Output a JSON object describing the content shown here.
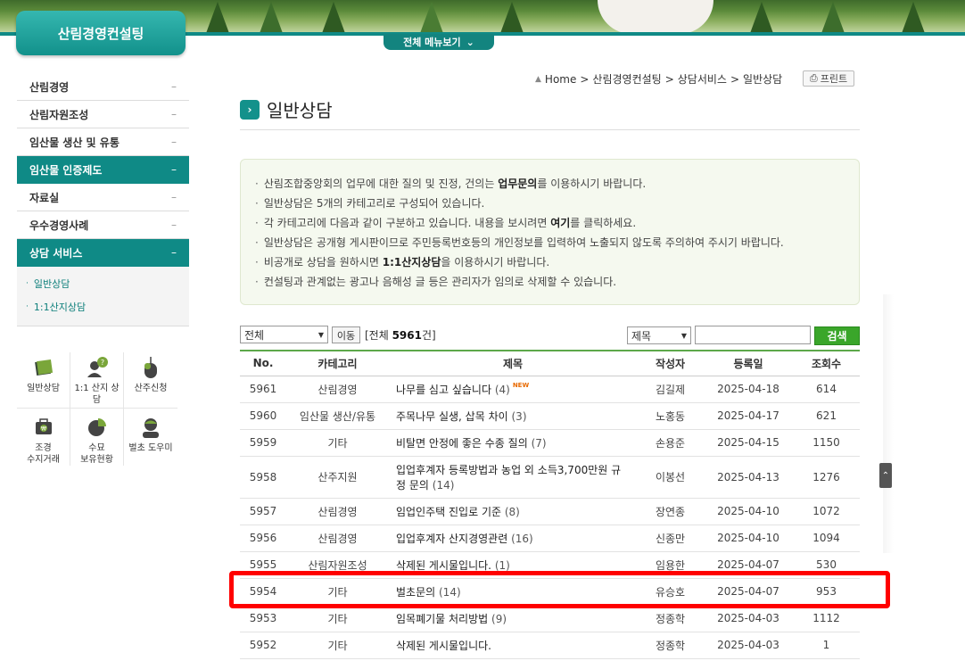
{
  "header": {
    "logo": "산림경영컨설팅",
    "all_menu": "전체 메뉴보기"
  },
  "lnb": {
    "items": [
      {
        "label": "산림경영",
        "mark": "–",
        "active": false
      },
      {
        "label": "산림자원조성",
        "mark": "–",
        "active": false
      },
      {
        "label": "임산물 생산 및 유통",
        "mark": "–",
        "active": false
      },
      {
        "label": "임산물 인증제도",
        "mark": "–",
        "active": true
      },
      {
        "label": "자료실",
        "mark": "–",
        "active": false
      },
      {
        "label": "우수경영사례",
        "mark": "–",
        "active": false
      },
      {
        "label": "상담 서비스",
        "mark": "–",
        "active": true
      }
    ],
    "sub_items": [
      {
        "label": "일반상담"
      },
      {
        "label": "1:1산지상담"
      }
    ]
  },
  "quick": {
    "row1": [
      {
        "label": "일반상담",
        "icon": "notebook-icon"
      },
      {
        "label": "1:1 산지 상담",
        "icon": "consultant-icon"
      },
      {
        "label": "산주신청",
        "icon": "mouse-icon"
      }
    ],
    "row2": [
      {
        "label1": "조경",
        "label2": "수지거래",
        "icon": "wallet-icon"
      },
      {
        "label1": "수묘",
        "label2": "보유현황",
        "icon": "pie-chart-icon"
      },
      {
        "label1": "벌초 도우미",
        "label2": "",
        "icon": "person-icon"
      }
    ]
  },
  "location": {
    "home": "Home",
    "path1": "산림경영컨설팅",
    "path2": "상담서비스",
    "path3": "일반상담",
    "sep": ">"
  },
  "print_label": "프린트",
  "page_title": "일반상담",
  "notice": {
    "line1_a": "산림조합중앙회의 업무에 대한 질의 및 진정, 건의는 ",
    "line1_b": "업무문의",
    "line1_c": "를 이용하시기 바랍니다.",
    "line2": "일반상담은 5개의 카테고리로 구성되어 있습니다.",
    "line3_a": "각 카테고리에 다음과 같이 구분하고 있습니다. 내용을 보시려면 ",
    "line3_b": "여기",
    "line3_c": "를 클릭하세요.",
    "line4": "일반상담은 공개형 게시판이므로 주민등록번호등의 개인정보를 입력하여 노출되지 않도록 주의하여 주시기 바랍니다.",
    "line5_a": "비공개로 상담을 원하시면 ",
    "line5_b": "1:1산지상담",
    "line5_c": "을 이용하시기 바랍니다.",
    "line6": "컨설팅과 관계없는 광고나 음해성 글 등은 관리자가 임의로 삭제할 수 있습니다.",
    "bullet": "·"
  },
  "filter": {
    "category_value": "전체",
    "move_label": "이동",
    "total_prefix": "[전체 ",
    "total_count": "5961",
    "total_suffix": "건]",
    "search_field_value": "제목",
    "search_label": "검색"
  },
  "board": {
    "headers": {
      "no": "No.",
      "category": "카테고리",
      "subject": "제목",
      "writer": "작성자",
      "date": "등록일",
      "views": "조회수"
    },
    "new_badge": "NEW",
    "rows": [
      {
        "no": "5961",
        "category": "산림경영",
        "subject": "나무를 심고 싶습니다",
        "comments": "(4)",
        "writer": "김길제",
        "date": "2025-04-18",
        "views": "614"
      },
      {
        "no": "5960",
        "category": "임산물 생산/유통",
        "subject": "주목나무 실생, 삽목 차이",
        "comments": "(3)",
        "writer": "노홍동",
        "date": "2025-04-17",
        "views": "621"
      },
      {
        "no": "5959",
        "category": "기타",
        "subject": "비탈면 안정에 좋은 수종 질의",
        "comments": "(7)",
        "writer": "손용준",
        "date": "2025-04-15",
        "views": "1150"
      },
      {
        "no": "5958",
        "category": "산주지원",
        "subject1": "입업후계자 등록방법과 농업 외 소득3,700만원 규",
        "subject2": "정 문의",
        "comments": "(14)",
        "writer": "이봉선",
        "date": "2025-04-13",
        "views": "1276"
      },
      {
        "no": "5957",
        "category": "산림경영",
        "subject": "임업인주택 진입로 기준",
        "comments": "(8)",
        "writer": "장연종",
        "date": "2025-04-10",
        "views": "1072"
      },
      {
        "no": "5956",
        "category": "산림경영",
        "subject": "입업후계자 산지경영관련",
        "comments": "(16)",
        "writer": "신종만",
        "date": "2025-04-10",
        "views": "1094"
      },
      {
        "no": "5955",
        "category": "산림자원조성",
        "subject": "삭제된 게시물입니다.",
        "comments": "(1)",
        "writer": "임용한",
        "date": "2025-04-07",
        "views": "530"
      },
      {
        "no": "5954",
        "category": "기타",
        "subject": "벌초문의",
        "comments": "(14)",
        "writer": "유승호",
        "date": "2025-04-07",
        "views": "953"
      },
      {
        "no": "5953",
        "category": "기타",
        "subject": "임목폐기물 처리방법",
        "comments": "(9)",
        "writer": "정종학",
        "date": "2025-04-03",
        "views": "1112"
      },
      {
        "no": "5952",
        "category": "기타",
        "subject": "삭제된 게시물입니다.",
        "comments": "",
        "writer": "정종학",
        "date": "2025-04-03",
        "views": "1"
      }
    ]
  },
  "colors": {
    "brand": "#0f8a86",
    "search": "#3aa62a",
    "highlight": "#ff0000"
  }
}
